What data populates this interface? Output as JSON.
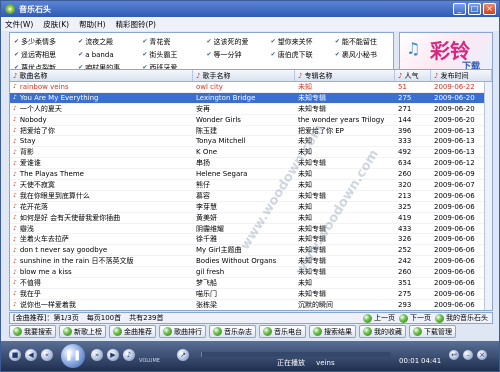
{
  "window": {
    "title": "音乐石头"
  },
  "menu": [
    "文件(W)",
    "皮肤(K)",
    "帮助(H)",
    "精彩图铃(P)"
  ],
  "categories": [
    "多少柔情多",
    "流夜之殿",
    "青花瓷",
    "这该死的爱",
    "望你来关怀",
    "能不能留住",
    "遥远寄相思",
    "a banda",
    "街头霸王",
    "等一分钟",
    "唐伯虎下联",
    "裹风小秘书",
    "蔑优点裂新",
    "咱村里的事",
    "西班牙爱"
  ],
  "banner": {
    "big": "彩铃",
    "small": "下载"
  },
  "table": {
    "headers": {
      "song": "歌曲名称",
      "singer": "歌手名称",
      "album": "专辑名称",
      "pop": "人气",
      "date": "发布时间"
    },
    "rows": [
      {
        "song": "rainbow veins",
        "singer": "owl city",
        "album": "未知",
        "pop": "51",
        "date": "2009-06-22",
        "style": "red"
      },
      {
        "song": "You Are My Everything",
        "singer": "Lexington Bridge",
        "album": "未知专辑",
        "pop": "275",
        "date": "2009-06-20",
        "style": "sel"
      },
      {
        "song": "一个人的夏天",
        "singer": "安再",
        "album": "未知专辑",
        "pop": "271",
        "date": "2009-06-20",
        "style": ""
      },
      {
        "song": "Nobody",
        "singer": "Wonder Girls",
        "album": "the wonder years Trilogy",
        "pop": "144",
        "date": "2009-06-20",
        "style": ""
      },
      {
        "song": "把爱给了你",
        "singer": "陈玉建",
        "album": "把爱给了你 EP",
        "pop": "396",
        "date": "2009-06-13",
        "style": ""
      },
      {
        "song": "Stay",
        "singer": "Tonya Mitchell",
        "album": "未知",
        "pop": "333",
        "date": "2009-06-13",
        "style": ""
      },
      {
        "song": "背影",
        "singer": "K One",
        "album": "未知",
        "pop": "492",
        "date": "2009-06-13",
        "style": ""
      },
      {
        "song": "爱谁谁",
        "singer": "串扬",
        "album": "未知专辑",
        "pop": "634",
        "date": "2009-06-12",
        "style": ""
      },
      {
        "song": "The Playas Theme",
        "singer": "Helene Segara",
        "album": "未知",
        "pop": "260",
        "date": "2009-06-09",
        "style": ""
      },
      {
        "song": "天使不寂寞",
        "singer": "熊仔",
        "album": "未知",
        "pop": "320",
        "date": "2009-06-07",
        "style": ""
      },
      {
        "song": "我在你眼里到底算什么",
        "singer": "慕容",
        "album": "未知专辑",
        "pop": "213",
        "date": "2009-06-06",
        "style": ""
      },
      {
        "song": "花开花落",
        "singer": "李芽慧",
        "album": "未知",
        "pop": "325",
        "date": "2009-06-06",
        "style": ""
      },
      {
        "song": "如何是好 会有天使替我爱你插曲",
        "singer": "黄美妍",
        "album": "未知",
        "pop": "419",
        "date": "2009-06-06",
        "style": ""
      },
      {
        "song": "瓣浅",
        "singer": "阴霾维耀",
        "album": "未知专辑",
        "pop": "433",
        "date": "2009-06-06",
        "style": ""
      },
      {
        "song": "坐着火车去拉萨",
        "singer": "徐千雅",
        "album": "未知专辑",
        "pop": "326",
        "date": "2009-06-06",
        "style": ""
      },
      {
        "song": "don t never say goodbye",
        "singer": "My Girl主题曲",
        "album": "未知专辑",
        "pop": "252",
        "date": "2009-06-06",
        "style": ""
      },
      {
        "song": "sunshine in the rain 日不落英文版",
        "singer": "Bodies Without Organs",
        "album": "未知专辑",
        "pop": "242",
        "date": "2009-06-06",
        "style": ""
      },
      {
        "song": "blow me a kiss",
        "singer": "gil fresh",
        "album": "未知专辑",
        "pop": "260",
        "date": "2009-06-06",
        "style": ""
      },
      {
        "song": "不值得",
        "singer": "梦飞船",
        "album": "未知",
        "pop": "351",
        "date": "2009-06-06",
        "style": ""
      },
      {
        "song": "我在乎",
        "singer": "喵乐门",
        "album": "未知专辑",
        "pop": "275",
        "date": "2009-06-06",
        "style": ""
      },
      {
        "song": "说你也一样爱着我",
        "singer": "张栋梁",
        "album": "沉默的瞬间",
        "pop": "293",
        "date": "2009-06-06",
        "style": ""
      }
    ]
  },
  "watermark": "www.woodown.com",
  "status": {
    "section": "[金曲推荐]：第1/3页",
    "per_page": "每页100首",
    "total": "共有239首"
  },
  "pager": {
    "prev": "上一页",
    "next": "下一页",
    "mine": "我的音乐石头"
  },
  "actions": [
    "我要搜索",
    "新歌上榜",
    "金曲推荐",
    "歌曲排行",
    "音乐杂志",
    "音乐电台",
    "搜索结果",
    "我的收藏",
    "下载管理"
  ],
  "player": {
    "now_label": "正在播放",
    "now_title": "veins",
    "elapsed": "00:01",
    "total": "04:41",
    "volume_label": "VOLUME",
    "progress": 0.004
  }
}
